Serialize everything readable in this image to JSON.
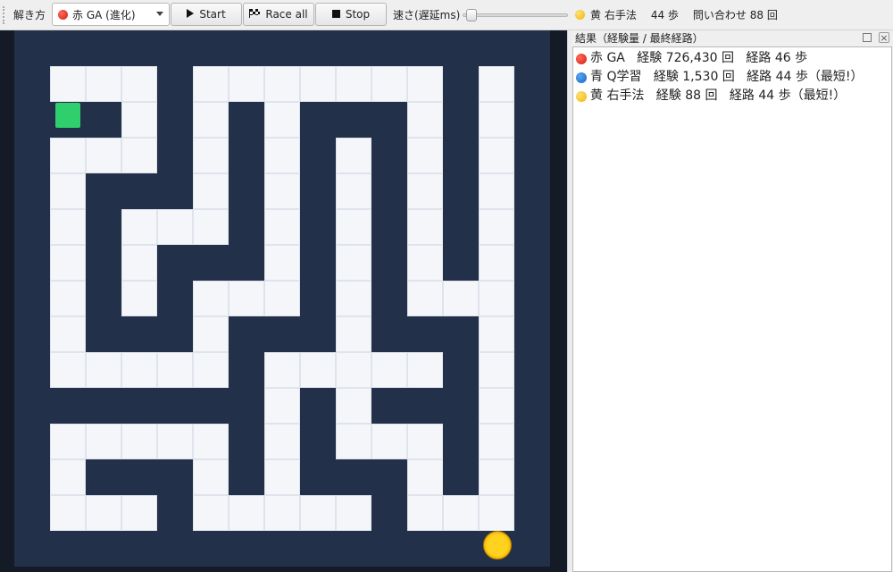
{
  "toolbar": {
    "method_label": "解き方",
    "method_selected": "赤 GA (進化)",
    "start_label": "Start",
    "race_label": "Race all",
    "stop_label": "Stop",
    "speed_label": "速さ(遅延ms)",
    "status": {
      "name": "黄 右手法",
      "steps": "44 歩",
      "queries": "問い合わせ 88 回"
    }
  },
  "maze": {
    "open_cells": [
      [
        2,
        1
      ],
      [
        3,
        1
      ],
      [
        4,
        1
      ],
      [
        6,
        1
      ],
      [
        7,
        1
      ],
      [
        8,
        1
      ],
      [
        9,
        1
      ],
      [
        10,
        1
      ],
      [
        11,
        1
      ],
      [
        12,
        1
      ],
      [
        14,
        1
      ],
      [
        4,
        2
      ],
      [
        6,
        2
      ],
      [
        8,
        2
      ],
      [
        12,
        2
      ],
      [
        14,
        2
      ],
      [
        2,
        3
      ],
      [
        3,
        3
      ],
      [
        4,
        3
      ],
      [
        6,
        3
      ],
      [
        8,
        3
      ],
      [
        10,
        3
      ],
      [
        12,
        3
      ],
      [
        14,
        3
      ],
      [
        2,
        4
      ],
      [
        6,
        4
      ],
      [
        8,
        4
      ],
      [
        10,
        4
      ],
      [
        12,
        4
      ],
      [
        14,
        4
      ],
      [
        2,
        5
      ],
      [
        4,
        5
      ],
      [
        5,
        5
      ],
      [
        6,
        5
      ],
      [
        8,
        5
      ],
      [
        10,
        5
      ],
      [
        12,
        5
      ],
      [
        14,
        5
      ],
      [
        2,
        6
      ],
      [
        4,
        6
      ],
      [
        8,
        6
      ],
      [
        10,
        6
      ],
      [
        12,
        6
      ],
      [
        14,
        6
      ],
      [
        2,
        7
      ],
      [
        4,
        7
      ],
      [
        6,
        7
      ],
      [
        7,
        7
      ],
      [
        8,
        7
      ],
      [
        10,
        7
      ],
      [
        12,
        7
      ],
      [
        13,
        7
      ],
      [
        14,
        7
      ],
      [
        2,
        8
      ],
      [
        6,
        8
      ],
      [
        10,
        8
      ],
      [
        14,
        8
      ],
      [
        2,
        9
      ],
      [
        3,
        9
      ],
      [
        4,
        9
      ],
      [
        5,
        9
      ],
      [
        6,
        9
      ],
      [
        8,
        9
      ],
      [
        9,
        9
      ],
      [
        10,
        9
      ],
      [
        11,
        9
      ],
      [
        12,
        9
      ],
      [
        14,
        9
      ],
      [
        8,
        10
      ],
      [
        10,
        10
      ],
      [
        14,
        10
      ],
      [
        2,
        11
      ],
      [
        3,
        11
      ],
      [
        4,
        11
      ],
      [
        5,
        11
      ],
      [
        6,
        11
      ],
      [
        8,
        11
      ],
      [
        10,
        11
      ],
      [
        11,
        11
      ],
      [
        12,
        11
      ],
      [
        14,
        11
      ],
      [
        2,
        12
      ],
      [
        6,
        12
      ],
      [
        8,
        12
      ],
      [
        12,
        12
      ],
      [
        14,
        12
      ],
      [
        2,
        13
      ],
      [
        3,
        13
      ],
      [
        4,
        13
      ],
      [
        6,
        13
      ],
      [
        7,
        13
      ],
      [
        8,
        13
      ],
      [
        9,
        13
      ],
      [
        10,
        13
      ],
      [
        12,
        13
      ],
      [
        13,
        13
      ],
      [
        14,
        13
      ]
    ]
  },
  "results": {
    "title": "結果（経験量 / 最終経路）",
    "rows": [
      {
        "color": "red",
        "text": "赤 GA   経験 726,430 回   経路 46 歩"
      },
      {
        "color": "blue",
        "text": "青 Q学習   経験 1,530 回   経路 44 歩（最短!）"
      },
      {
        "color": "yellow",
        "text": "黄 右手法   経験 88 回   経路 44 歩（最短!）"
      }
    ]
  },
  "colors": {
    "wall": "#223049",
    "path": "#f4f6fa",
    "start": "#2fcf6d",
    "agent": "#ffd21f"
  },
  "icons": {
    "start": "play-icon",
    "race": "checkered-flag-icon",
    "stop": "stop-icon"
  }
}
